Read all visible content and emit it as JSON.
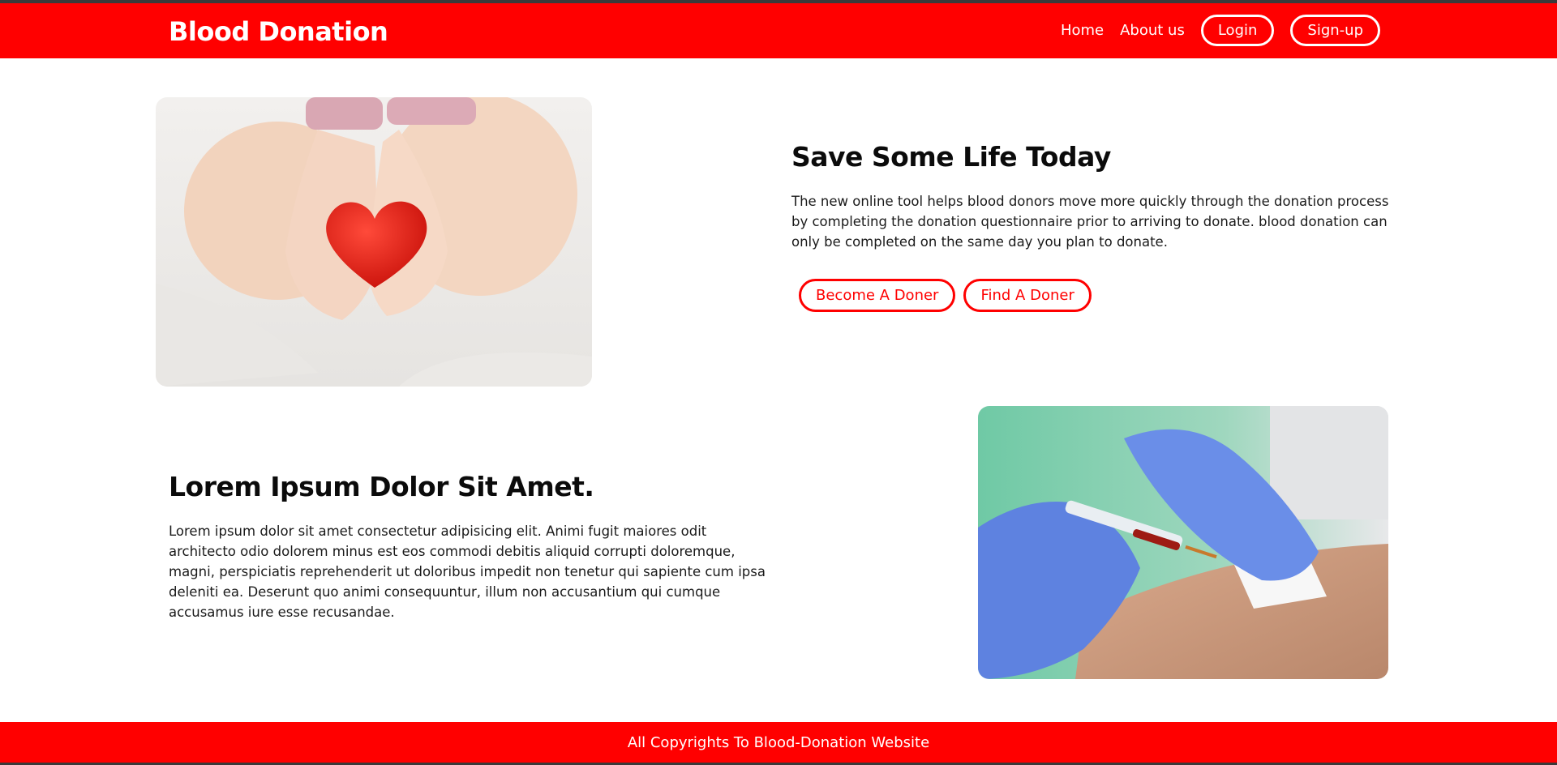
{
  "header": {
    "brand": "Blood Donation",
    "nav": {
      "home": "Home",
      "about": "About us",
      "login": "Login",
      "signup": "Sign-up"
    }
  },
  "hero": {
    "title": "Save Some Life Today",
    "description": "The new online tool helps blood donors move more quickly through the donation process by completing the donation questionnaire prior to arriving to donate. blood donation can only be completed on the same day you plan to donate.",
    "buttons": {
      "become": "Become A Doner",
      "find": "Find A Doner"
    }
  },
  "info": {
    "title": "Lorem Ipsum Dolor Sit Amet.",
    "description": "Lorem ipsum dolor sit amet consectetur adipisicing elit. Animi fugit maiores odit architecto odio dolorem minus est eos commodi debitis aliquid corrupti doloremque, magni, perspiciatis reprehenderit ut doloribus impedit non tenetur qui sapiente cum ipsa deleniti ea. Deserunt quo animi consequuntur, illum non accusantium qui cumque accusamus iure esse recusandae."
  },
  "footer": {
    "text": "All Copyrights To Blood-Donation Website"
  },
  "colors": {
    "accent": "#ff0000",
    "background": "#ffffff"
  }
}
